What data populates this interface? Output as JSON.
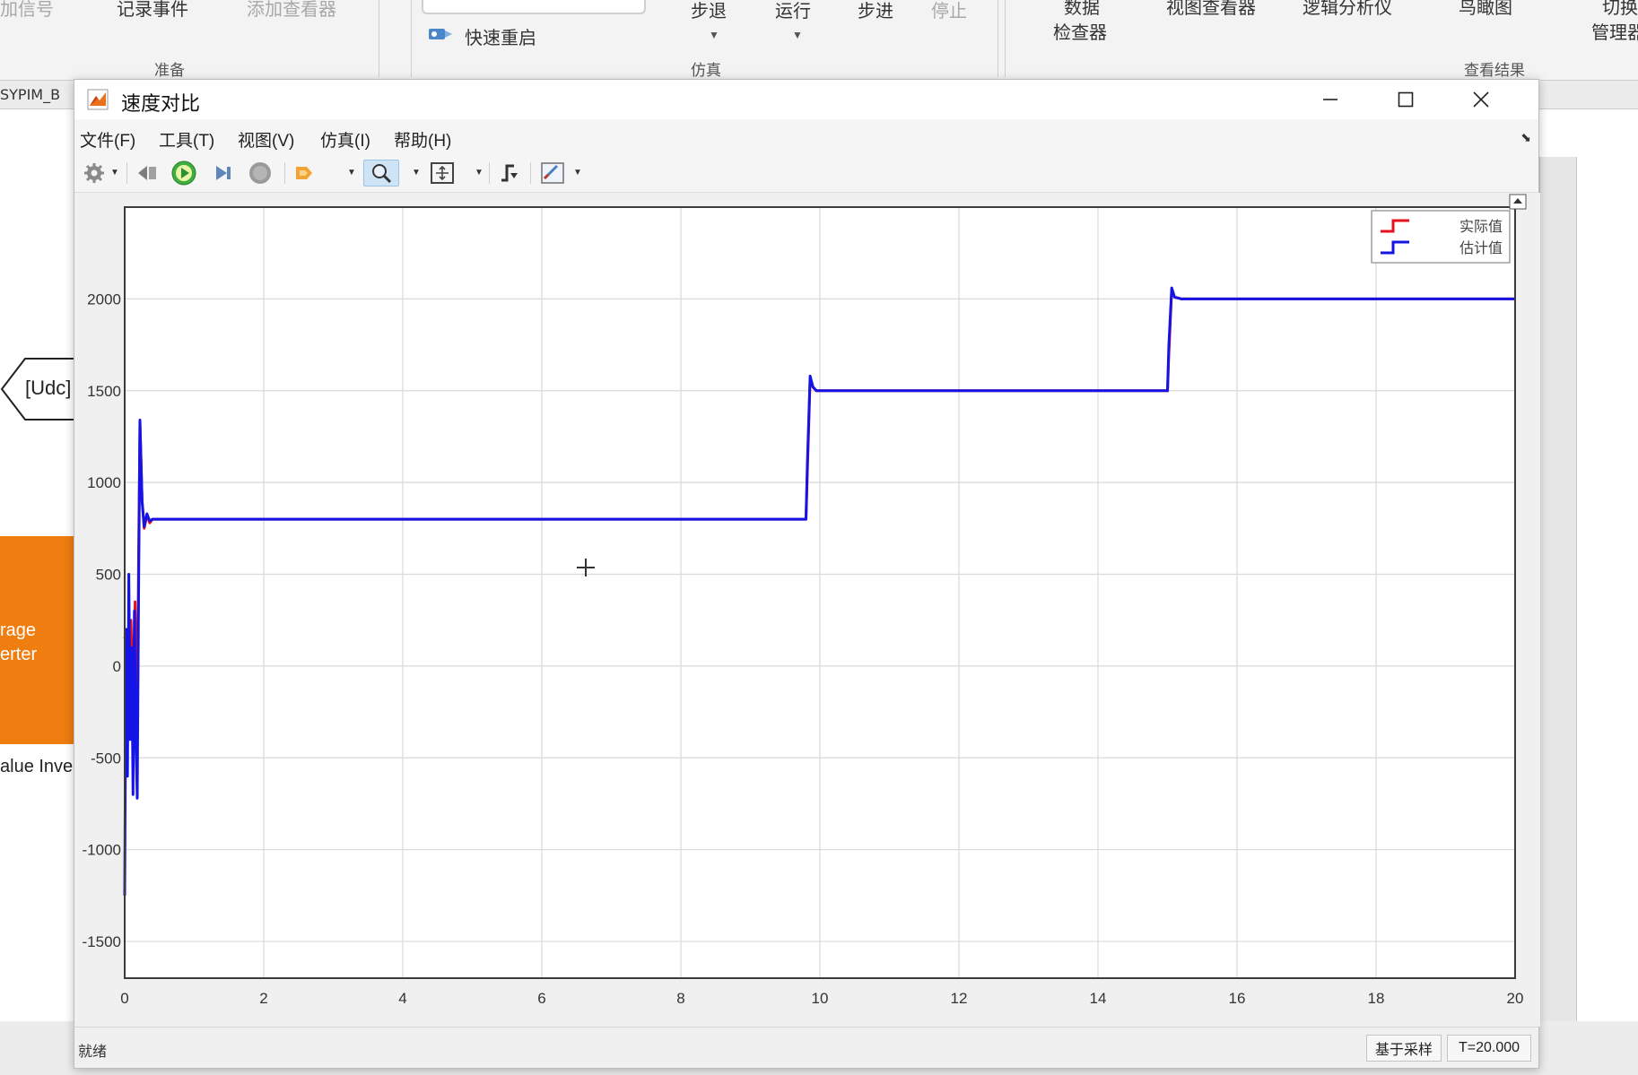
{
  "background": {
    "ribbon": {
      "row1": [
        {
          "id": "cut1",
          "text": "添加信号",
          "dim": true
        },
        {
          "id": "cut2",
          "text": "记录事件",
          "dim": false
        },
        {
          "id": "cut3",
          "text": "添加查看器",
          "dim": true
        },
        {
          "id": "step_back",
          "text": "步退",
          "dim": false
        },
        {
          "id": "run",
          "text": "运行",
          "dim": false
        },
        {
          "id": "step_fwd",
          "text": "步进",
          "dim": false
        },
        {
          "id": "stop",
          "text": "停止",
          "dim": true
        },
        {
          "id": "data_top",
          "text": "数据",
          "dim": false
        },
        {
          "id": "logic_viewer",
          "text": "视图查看器",
          "dim": false
        },
        {
          "id": "logic_analyzer",
          "text": "逻辑分析仪",
          "dim": false
        },
        {
          "id": "bird",
          "text": "鸟瞰图",
          "dim": false
        },
        {
          "id": "switch_top",
          "text": "切换",
          "dim": false
        }
      ],
      "data_inspector_bottom": "检查器",
      "manager_bottom": "管理器",
      "fast_restart": "快速重启",
      "groups": {
        "prepare": "准备",
        "simulate": "仿真",
        "review": "查看结果"
      }
    },
    "model_tab": "SYPIM_B",
    "goto_tag": "[Udc]",
    "orange_block_text": "rage\nerter",
    "block_caption": "alue Inve"
  },
  "scope": {
    "title": "速度对比",
    "menu": [
      "文件(F)",
      "工具(T)",
      "视图(V)",
      "仿真(I)",
      "帮助(H)"
    ],
    "toolbar_icons": [
      "settings-icon",
      "step-back-icon",
      "run-icon",
      "step-forward-icon",
      "stop-icon",
      "highlight-icon",
      "zoom-icon",
      "autoscale-icon",
      "triggers-icon",
      "measurements-icon"
    ],
    "status": {
      "left": "就绪",
      "sample_mode": "基于采样",
      "time": "T=20.000"
    }
  },
  "chart_data": {
    "type": "line",
    "title": "",
    "xlabel": "",
    "ylabel": "",
    "xlim": [
      0,
      20
    ],
    "ylim": [
      -1700,
      2500
    ],
    "xticks": [
      0,
      2,
      4,
      6,
      8,
      10,
      12,
      14,
      16,
      18,
      20
    ],
    "yticks": [
      -1500,
      -1000,
      -500,
      0,
      500,
      1000,
      1500,
      2000
    ],
    "grid": true,
    "legend_position": "top-right",
    "series": [
      {
        "name": "实际值",
        "color": "#e8121c",
        "x": [
          0,
          0.03,
          0.06,
          0.09,
          0.12,
          0.15,
          0.18,
          0.2,
          0.22,
          0.25,
          0.28,
          0.32,
          0.36,
          0.4,
          1,
          5,
          9.8,
          9.82,
          9.86,
          9.9,
          9.95,
          10,
          15,
          15.02,
          15.06,
          15.1,
          15.2,
          20
        ],
        "y": [
          150,
          200,
          -100,
          250,
          -200,
          350,
          -400,
          600,
          1330,
          900,
          750,
          820,
          780,
          800,
          800,
          800,
          800,
          1050,
          1560,
          1520,
          1500,
          1500,
          1500,
          1700,
          2050,
          2010,
          2000,
          2000
        ]
      },
      {
        "name": "估计值",
        "color": "#1414e6",
        "x": [
          0,
          0.02,
          0.04,
          0.06,
          0.08,
          0.1,
          0.12,
          0.14,
          0.16,
          0.18,
          0.2,
          0.22,
          0.25,
          0.28,
          0.32,
          0.36,
          0.4,
          1,
          5,
          9.8,
          9.82,
          9.86,
          9.9,
          9.95,
          10,
          15,
          15.02,
          15.06,
          15.1,
          15.2,
          20
        ],
        "y": [
          -1250,
          200,
          -600,
          500,
          -400,
          100,
          -700,
          300,
          -400,
          -720,
          400,
          1340,
          900,
          760,
          830,
          790,
          800,
          800,
          800,
          800,
          1100,
          1580,
          1520,
          1500,
          1500,
          1500,
          1750,
          2060,
          2010,
          2000,
          2000
        ]
      }
    ]
  }
}
